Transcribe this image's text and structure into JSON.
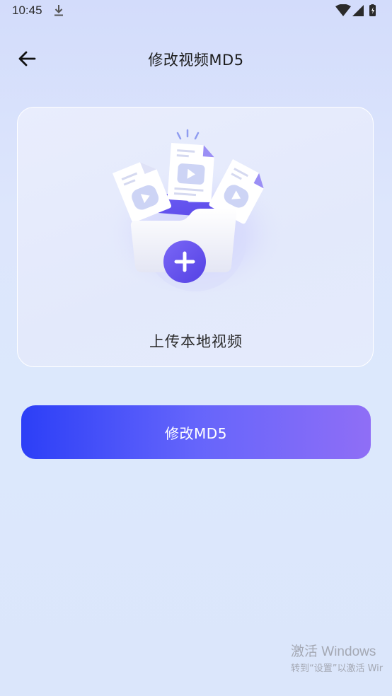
{
  "status_bar": {
    "time": "10:45",
    "icons": [
      "download-icon",
      "wifi-icon",
      "signal-icon",
      "battery-icon"
    ]
  },
  "header": {
    "title": "修改视频MD5",
    "back_icon": "arrow-left-icon"
  },
  "upload_card": {
    "label": "上传本地视频",
    "illustration_icons": [
      "video-file-icon",
      "folder-icon",
      "plus-icon"
    ]
  },
  "action": {
    "modify_label": "修改MD5"
  },
  "watermark": {
    "title": "激活 Windows",
    "subtitle": "转到“设置”以激活 Wir"
  },
  "colors": {
    "accent_start": "#2c3ff7",
    "accent_end": "#8f6ef6",
    "folder_purple": "#6758f2"
  }
}
